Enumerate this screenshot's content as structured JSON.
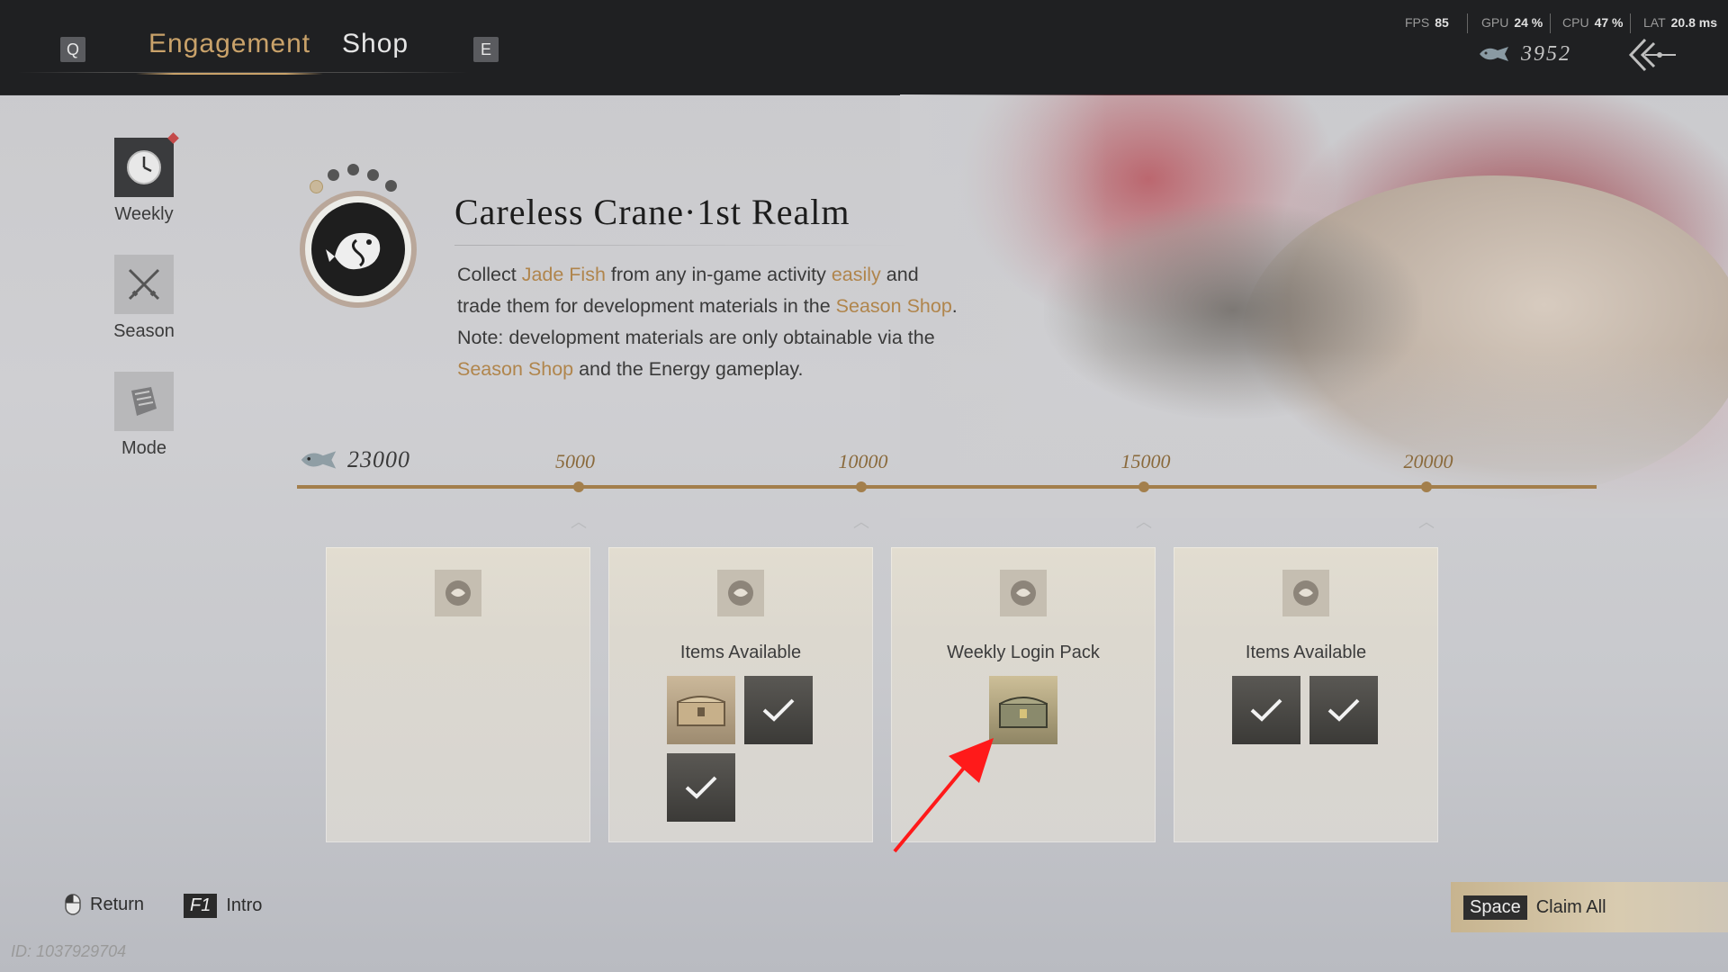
{
  "topbar": {
    "key_left": "Q",
    "key_right": "E",
    "tabs": [
      {
        "label": "Engagement",
        "active": true
      },
      {
        "label": "Shop",
        "active": false
      }
    ],
    "perf": {
      "fps_label": "FPS",
      "fps_value": "85",
      "gpu_label": "GPU",
      "gpu_value": "24 %",
      "cpu_label": "CPU",
      "cpu_value": "47 %",
      "lat_label": "LAT",
      "lat_value": "20.8 ms"
    },
    "currency_value": "3952",
    "currency_icon": "jade-fish-icon",
    "back_icon": "back-arrow-icon"
  },
  "sidebar": {
    "items": [
      {
        "label": "Weekly",
        "icon": "clock-icon",
        "notify": true
      },
      {
        "label": "Season",
        "icon": "crossed-swords-icon",
        "notify": false
      },
      {
        "label": "Mode",
        "icon": "scroll-icon",
        "notify": false
      }
    ]
  },
  "event": {
    "title": "Careless Crane·1st Realm",
    "emblem_icon": "koi-emblem-icon",
    "desc": {
      "p1_a": "Collect ",
      "p1_hl1": "Jade Fish",
      "p1_b": " from any in-game activity ",
      "p1_hl2": "easily",
      "p1_c": " and trade them for development materials in the ",
      "p1_hl3": "Season Shop",
      "p1_d": ".",
      "p2_a": "Note: development materials are only obtainable via the ",
      "p2_hl1": "Season Shop",
      "p2_b": " and the Energy gameplay."
    }
  },
  "progress": {
    "total": "23000",
    "current_fraction": 1.0,
    "milestones": [
      "5000",
      "10000",
      "15000",
      "20000"
    ]
  },
  "rewards": [
    {
      "label": "",
      "items": []
    },
    {
      "label": "Items Available",
      "items": [
        "chest-icon",
        "claimed-check-icon",
        "claimed-check-icon"
      ]
    },
    {
      "label": "Weekly Login Pack",
      "items": [
        "chest-icon"
      ]
    },
    {
      "label": "Items Available",
      "items": [
        "claimed-check-icon",
        "claimed-check-icon"
      ]
    }
  ],
  "footer": {
    "return_label": "Return",
    "intro_key": "F1",
    "intro_label": "Intro",
    "claim_key": "Space",
    "claim_label": "Claim All",
    "uid": "ID: 1037929704"
  },
  "colors": {
    "accent_gold": "#c9a26a",
    "track": "#a37f4c",
    "annotation_arrow": "#ff1a1a"
  }
}
